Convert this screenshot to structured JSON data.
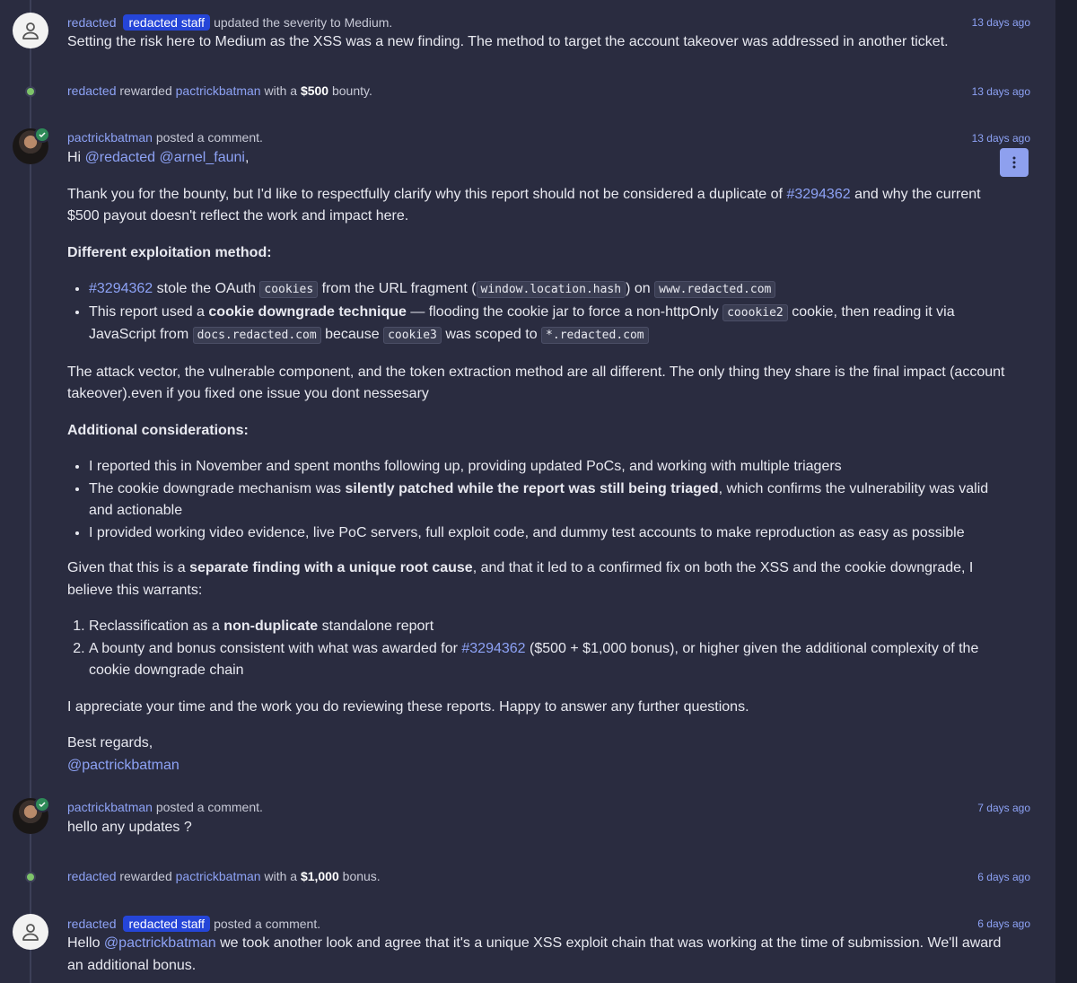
{
  "colors": {
    "background": "#2a2c40",
    "link": "#8da2f5",
    "badge": "#2545d8",
    "bounty_dot": "#7ec46a"
  },
  "activity": [
    {
      "user": "redacted",
      "badge": "redacted staff",
      "action": "updated the severity to Medium.",
      "time": "13 days ago",
      "text": "Setting the risk here to Medium as the XSS was a new finding. The method to target the account takeover was addressed in another ticket."
    },
    {
      "user": "redacted",
      "mid": "rewarded",
      "target": "pactrickbatman",
      "pre_amount": "with a",
      "amount": "$500",
      "post_amount": "bounty.",
      "time": "13 days ago"
    },
    {
      "user": "pactrickbatman",
      "action": "posted a comment.",
      "time": "13 days ago",
      "greeting": {
        "hi": "Hi",
        "mention1": "@redacted",
        "mention2": "@arnel_fauni",
        "comma": ","
      },
      "p1": {
        "a": "Thank you for the bounty, but I'd like to respectfully clarify why this report should not be considered a duplicate of",
        "link": "#3294362",
        "b": "and why the current $500 payout doesn't reflect the work and impact here."
      },
      "h1": "Different exploitation method:",
      "bullet1": {
        "link": "#3294362",
        "a": "stole the OAuth",
        "c1": "cookies",
        "b": "from the URL fragment (",
        "c2": "window.location.hash",
        "c": ") on",
        "c3": "www.redacted.com"
      },
      "bullet2": {
        "a": "This report used a",
        "bold": "cookie downgrade technique",
        "b": "— flooding the cookie jar to force a non-httpOnly",
        "c1": "coookie2",
        "c": "cookie, then reading it via JavaScript from",
        "c2": "docs.redacted.com",
        "d": "because",
        "c3": "cookie3",
        "e": "was scoped to",
        "c4": "*.redacted.com"
      },
      "p2": "The attack vector, the vulnerable component, and the token extraction method are all different. The only thing they share is the final impact (account takeover).even if you fixed one issue you dont nessesary",
      "h2": "Additional considerations:",
      "bullet3": "I reported this in November and spent months following up, providing updated PoCs, and working with multiple triagers",
      "bullet4": {
        "a": "The cookie downgrade mechanism was",
        "bold": "silently patched while the report was still being triaged",
        "b": ", which confirms the vulnerability was valid and actionable"
      },
      "bullet5": "I provided working video evidence, live PoC servers, full exploit code, and dummy test accounts to make reproduction as easy as possible",
      "p3": {
        "a": "Given that this is a",
        "bold": "separate finding with a unique root cause",
        "b": ", and that it led to a confirmed fix on both the XSS and the cookie downgrade, I believe this warrants:"
      },
      "ol1": {
        "a": "Reclassification as a",
        "bold": "non-duplicate",
        "b": "standalone report"
      },
      "ol2": {
        "a": "A bounty and bonus consistent with what was awarded for",
        "link": "#3294362",
        "b": "($500 + $1,000 bonus), or higher given the additional complexity of the cookie downgrade chain"
      },
      "p4": "I appreciate your time and the work you do reviewing these reports. Happy to answer any further questions.",
      "sign": "Best regards,",
      "sign_mention": "@pactrickbatman"
    },
    {
      "user": "pactrickbatman",
      "action": "posted a comment.",
      "time": "7 days ago",
      "text": "hello any updates ?"
    },
    {
      "user": "redacted",
      "mid": "rewarded",
      "target": "pactrickbatman",
      "pre_amount": "with a",
      "amount": "$1,000",
      "post_amount": "bonus.",
      "time": "6 days ago"
    },
    {
      "user": "redacted",
      "badge": "redacted staff",
      "action": "posted a comment.",
      "time": "6 days ago",
      "text_a": "Hello",
      "mention": "@pactrickbatman",
      "text_b": "we took another look and agree that it's a unique XSS exploit chain that was working at the time of submission. We'll award an additional bonus."
    }
  ]
}
